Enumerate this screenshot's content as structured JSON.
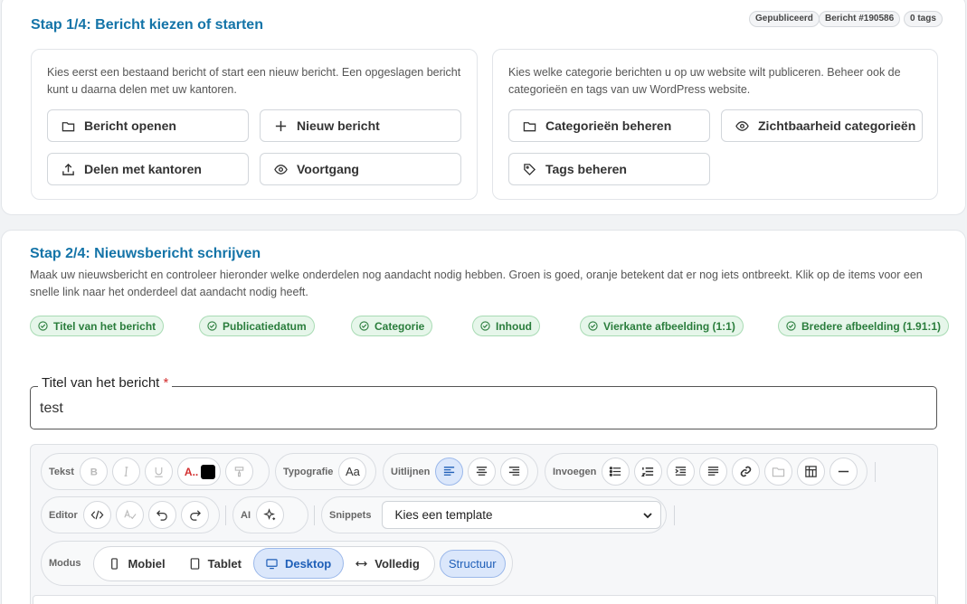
{
  "step1": {
    "title": "Stap 1/4: Bericht kiezen of starten",
    "badges": [
      "Gepubliceerd",
      "Bericht #190586",
      "0 tags"
    ],
    "left_text": "Kies eerst een bestaand bericht of start een nieuw bericht. Een opgeslagen bericht kunt u daarna delen met uw kantoren.",
    "left_buttons": [
      "Bericht openen",
      "Nieuw bericht",
      "Delen met kantoren",
      "Voortgang"
    ],
    "right_text": "Kies welke categorie berichten u op uw website wilt publiceren. Beheer ook de categorieën en tags van uw WordPress website.",
    "right_buttons": [
      "Categorieën beheren",
      "Zichtbaarheid categorieën",
      "Tags beheren"
    ]
  },
  "step2": {
    "title": "Stap 2/4: Nieuwsbericht schrijven",
    "description": "Maak uw nieuwsbericht en controleer hieronder welke onderdelen nog aandacht nodig hebben. Groen is goed, oranje betekent dat er nog iets ontbreekt. Klik op de items voor een snelle link naar het onderdeel dat aandacht nodig heeft.",
    "checks": [
      "Titel van het bericht",
      "Publicatiedatum",
      "Categorie",
      "Inhoud",
      "Vierkante afbeelding (1:1)",
      "Bredere afbeelding (1.91:1)"
    ],
    "check_color": "#2a7d3c",
    "title_field": {
      "label": "Titel van het bericht",
      "required_mark": "*",
      "value": "test"
    }
  },
  "toolbar": {
    "groups": {
      "text": "Tekst",
      "typography": "Typografie",
      "align": "Uitlijnen",
      "insert": "Invoegen",
      "editor": "Editor",
      "ai": "AI",
      "snippets": "Snippets",
      "mode": "Modus"
    },
    "color_label": "A..",
    "typography_button": "Aa",
    "snippet_select": "Kies een template",
    "modes": [
      "Mobiel",
      "Tablet",
      "Desktop",
      "Volledig"
    ],
    "active_mode": "Desktop",
    "structure_button": "Structuur"
  },
  "colors": {
    "accent": "#1474a8",
    "active": "#1f5fb8"
  }
}
